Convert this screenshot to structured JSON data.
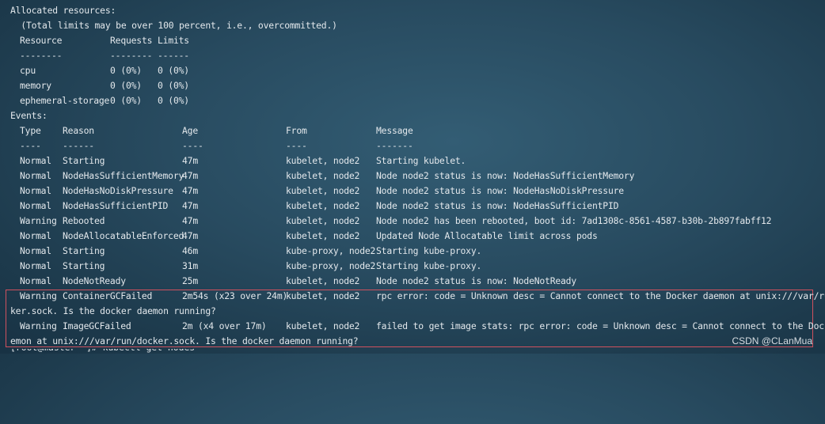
{
  "allocated": {
    "header": "Allocated resources:",
    "note": "  (Total limits may be over 100 percent, i.e., overcommitted.)",
    "columns": [
      "Resource",
      "Requests",
      "Limits"
    ],
    "dashes": [
      "--------",
      "--------",
      "------"
    ],
    "rows": [
      [
        "cpu",
        "0 (0%)",
        "0 (0%)"
      ],
      [
        "memory",
        "0 (0%)",
        "0 (0%)"
      ],
      [
        "ephemeral-storage",
        "0 (0%)",
        "0 (0%)"
      ]
    ]
  },
  "events": {
    "header": "Events:",
    "columns": [
      "Type",
      "Reason",
      "Age",
      "From",
      "Message"
    ],
    "dashes": [
      "----",
      "------",
      "----",
      "----",
      "-------"
    ],
    "rows": [
      [
        "Normal",
        "Starting",
        "47m",
        "kubelet, node2",
        "Starting kubelet."
      ],
      [
        "Normal",
        "NodeHasSufficientMemory",
        "47m",
        "kubelet, node2",
        "Node node2 status is now: NodeHasSufficientMemory"
      ],
      [
        "Normal",
        "NodeHasNoDiskPressure",
        "47m",
        "kubelet, node2",
        "Node node2 status is now: NodeHasNoDiskPressure"
      ],
      [
        "Normal",
        "NodeHasSufficientPID",
        "47m",
        "kubelet, node2",
        "Node node2 status is now: NodeHasSufficientPID"
      ],
      [
        "Warning",
        "Rebooted",
        "47m",
        "kubelet, node2",
        "Node node2 has been rebooted, boot id: 7ad1308c-8561-4587-b30b-2b897fabff12"
      ],
      [
        "Normal",
        "NodeAllocatableEnforced",
        "47m",
        "kubelet, node2",
        "Updated Node Allocatable limit across pods"
      ],
      [
        "Normal",
        "Starting",
        "46m",
        "kube-proxy, node2",
        "Starting kube-proxy."
      ],
      [
        "Normal",
        "Starting",
        "31m",
        "kube-proxy, node2",
        "Starting kube-proxy."
      ],
      [
        "Normal",
        "NodeNotReady",
        "25m",
        "kubelet, node2",
        "Node node2 status is now: NodeNotReady"
      ]
    ],
    "highlighted": [
      {
        "cells": [
          "Warning",
          "ContainerGCFailed",
          "2m54s (x23 over 24m)",
          "kubelet, node2",
          "rpc error: code = Unknown desc = Cannot connect to the Docker daemon at unix:///var/run/doc"
        ],
        "wrap": "ker.sock. Is the docker daemon running?"
      },
      {
        "cells": [
          "Warning",
          "ImageGCFailed",
          "2m (x4 over 17m)",
          "kubelet, node2",
          "failed to get image stats: rpc error: code = Unknown desc = Cannot connect to the Docker da"
        ],
        "wrap": "emon at unix:///var/run/docker.sock. Is the docker daemon running?"
      }
    ]
  },
  "next_line_partial": "[root@master ~]# kubectl get nodes",
  "watermark": "CSDN @CLanMua",
  "colors": {
    "highlight_border": "#d0515e",
    "text": "#e3e8ec"
  }
}
